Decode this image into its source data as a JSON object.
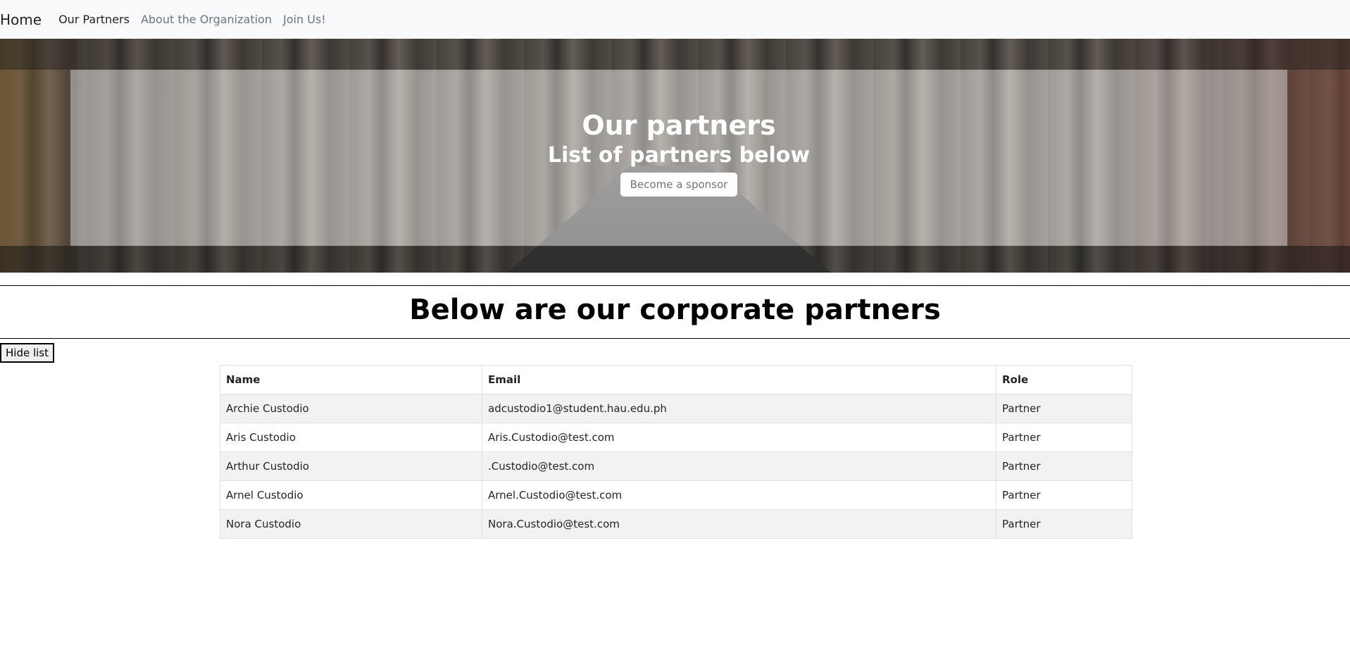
{
  "nav": {
    "brand": "Home",
    "links": [
      {
        "label": "Our Partners",
        "active": true
      },
      {
        "label": "About the Organization",
        "active": false
      },
      {
        "label": "Join Us!",
        "active": false
      }
    ]
  },
  "hero": {
    "title": "Our partners",
    "subtitle": "List of partners below",
    "button": "Become a sponsor"
  },
  "section": {
    "title": "Below are our corporate partners",
    "toggle_button": "Hide list"
  },
  "table": {
    "headers": [
      "Name",
      "Email",
      "Role"
    ],
    "rows": [
      [
        "Archie Custodio",
        "adcustodio1@student.hau.edu.ph",
        "Partner"
      ],
      [
        "Aris Custodio",
        "Aris.Custodio@test.com",
        "Partner"
      ],
      [
        "Arthur Custodio",
        ".Custodio@test.com",
        "Partner"
      ],
      [
        "Arnel Custodio",
        "Arnel.Custodio@test.com",
        "Partner"
      ],
      [
        "Nora Custodio",
        "Nora.Custodio@test.com",
        "Partner"
      ]
    ]
  }
}
